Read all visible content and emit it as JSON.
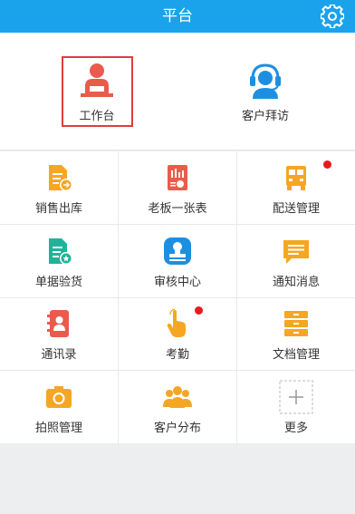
{
  "header": {
    "title": "平台",
    "settings_icon": "gear-icon"
  },
  "top": {
    "workbench_label": "工作台",
    "visit_label": "客户拜访"
  },
  "grid": {
    "sales_out": "销售出库",
    "boss_sheet": "老板一张表",
    "delivery": "配送管理",
    "receipt_check": "单据验货",
    "audit_center": "审核中心",
    "notices": "通知消息",
    "contacts": "通讯录",
    "attendance": "考勤",
    "documents": "文档管理",
    "photo": "拍照管理",
    "customer_map": "客户分布",
    "more": "更多"
  },
  "colors": {
    "header": "#1aa3ea",
    "orange": "#f5a623",
    "red": "#ea5b4c",
    "blue": "#1e8fe0",
    "teal": "#20b39a",
    "badge": "#e8191f",
    "highlight": "#e03c3c"
  }
}
